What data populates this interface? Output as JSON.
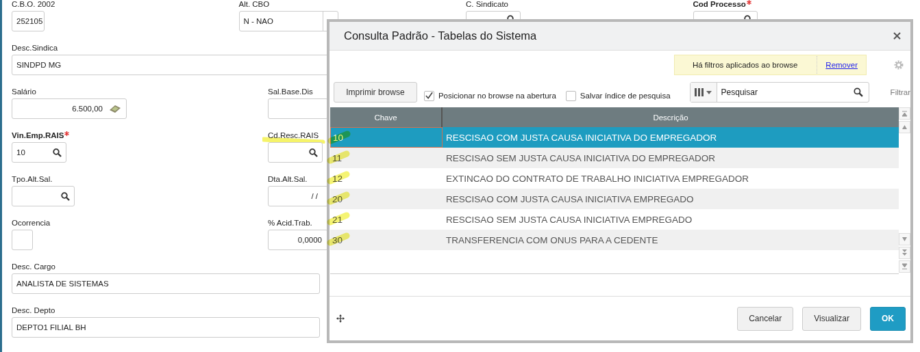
{
  "form": {
    "rows": [
      [
        {
          "label": "C.B.O. 2002",
          "value": "252105",
          "kind": "text",
          "required": false
        },
        {
          "label": "Alt. CBO",
          "value": "N - NAO",
          "kind": "select",
          "required": false
        },
        {
          "label": "C. Sindicato",
          "kind": "search",
          "required": false
        },
        {
          "label": "Cod Processo",
          "kind": "search",
          "required": true
        }
      ],
      [
        {
          "label": "Desc.Sindica",
          "value": "SINDPD MG",
          "kind": "text",
          "required": false
        }
      ],
      [
        {
          "label": "Salário",
          "value": "6.500,00",
          "kind": "money",
          "required": false
        },
        {
          "label": "Sal.Base.Dis",
          "kind": "text",
          "required": false
        }
      ],
      [
        {
          "label": "Vin.Emp.RAIS",
          "value": "10",
          "kind": "search",
          "required": true
        },
        {
          "label": "Cd.Resc.RAIS",
          "kind": "search",
          "required": false,
          "marked": true
        }
      ],
      [
        {
          "label": "Tpo.Alt.Sal.",
          "kind": "search",
          "required": false
        },
        {
          "label": "Dta.Alt.Sal.",
          "value": "/ /",
          "kind": "date",
          "required": false
        }
      ],
      [
        {
          "label": "Ocorrencia",
          "kind": "text",
          "required": false
        },
        {
          "label": "% Acid.Trab.",
          "value": "0,0000",
          "kind": "number",
          "required": false
        }
      ],
      [
        {
          "label": "Desc. Cargo",
          "value": "ANALISTA DE SISTEMAS",
          "kind": "text",
          "required": false
        }
      ],
      [
        {
          "label": "Desc. Depto",
          "value": "DEPTO1 FILIAL BH",
          "kind": "text",
          "required": false
        }
      ]
    ]
  },
  "dialog": {
    "title": "Consulta Padrão - Tabelas do Sistema",
    "filter_notice": {
      "text": "Há filtros aplicados ao browse",
      "link": "Remover"
    },
    "print_button": "Imprimir browse",
    "checkboxes": [
      {
        "label": "Posicionar no browse na abertura",
        "checked": true
      },
      {
        "label": "Salvar índice de pesquisa",
        "checked": false
      }
    ],
    "search": {
      "placeholder": "Pesquisar"
    },
    "filter_label": "Filtrar",
    "table": {
      "columns": [
        "Chave",
        "Descrição"
      ],
      "rows": [
        {
          "key": "10",
          "description": "RESCISAO COM JUSTA CAUSA INICIATIVA DO EMPREGADOR",
          "selected": true,
          "marked": true
        },
        {
          "key": "11",
          "description": "RESCISAO SEM JUSTA CAUSA INICIATIVA DO EMPREGADOR",
          "selected": false,
          "marked": true
        },
        {
          "key": "12",
          "description": "EXTINCAO DO CONTRATO DE TRABALHO INICIATIVA EMPREGADOR",
          "selected": false,
          "marked": true
        },
        {
          "key": "20",
          "description": "RESCISAO COM JUSTA CAUSA INICIATIVA EMPREGADO",
          "selected": false,
          "marked": true
        },
        {
          "key": "21",
          "description": "RESCISAO SEM JUSTA CAUSA INICIATIVA EMPREGADO",
          "selected": false,
          "marked": true
        },
        {
          "key": "30",
          "description": "TRANSFERENCIA COM ONUS PARA A CEDENTE",
          "selected": false,
          "marked": true
        }
      ]
    },
    "buttons": [
      {
        "label": "Cancelar",
        "kind": "secondary"
      },
      {
        "label": "Visualizar",
        "kind": "secondary"
      },
      {
        "label": "OK",
        "kind": "primary"
      }
    ]
  }
}
